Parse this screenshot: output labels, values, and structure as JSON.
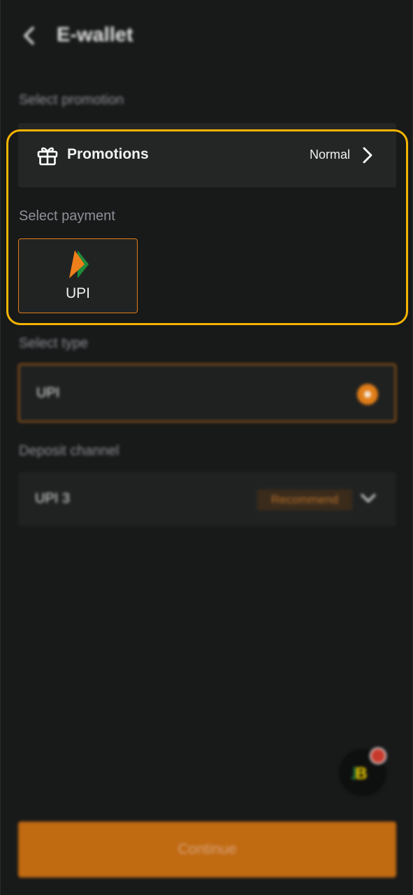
{
  "header": {
    "title": "E-wallet"
  },
  "promotion": {
    "section_label": "Select promotion",
    "label": "Promotions",
    "value": "Normal"
  },
  "payment": {
    "section_label": "Select payment",
    "options": [
      {
        "label": "UPI",
        "selected": true
      }
    ]
  },
  "type": {
    "section_label": "Select type",
    "selected_label": "UPI"
  },
  "channel": {
    "section_label": "Deposit channel",
    "selected_label": "UPI 3",
    "badge": "Recommend"
  },
  "floating_button": {
    "mark_part1": "˩",
    "mark_part2": "B"
  },
  "footer": {
    "continue_label": "Continue"
  },
  "colors": {
    "accent": "#e07d17",
    "highlight_outline": "#f6b400",
    "background": "#181919",
    "card": "#242626"
  },
  "icons": {
    "back": "chevron-left-icon",
    "gift": "gift-icon",
    "chevron_right": "chevron-right-icon",
    "chevron_down": "chevron-down-icon",
    "upi_logo": "upi-logo-icon"
  }
}
